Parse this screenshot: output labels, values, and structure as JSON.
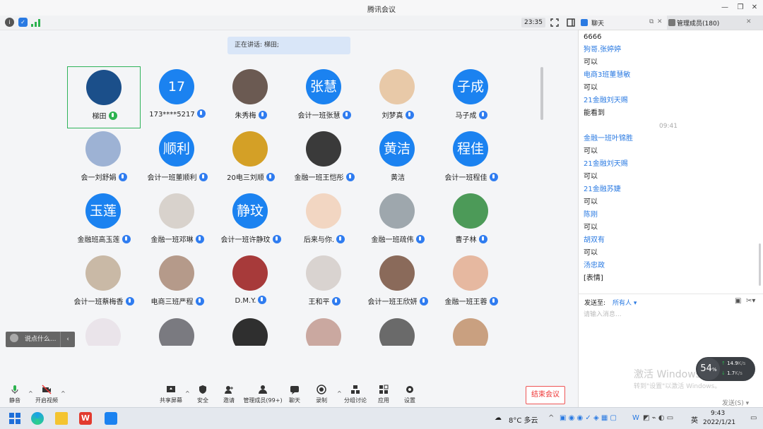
{
  "app": {
    "title": "腾讯会议"
  },
  "meeting": {
    "time": "23:35",
    "speaking_label": "正在讲话: 梯田;",
    "participants": [
      {
        "name": "梯田",
        "avatar_text": "",
        "avatar_color": "#1b4f8a",
        "mic": "green",
        "selected": true
      },
      {
        "name": "173****5217",
        "avatar_text": "17",
        "mic": "blue"
      },
      {
        "name": "朱秀梅",
        "avatar_text": "",
        "avatar_color": "#6b5a52",
        "mic": "blue"
      },
      {
        "name": "会计一班张慧",
        "avatar_text": "张慧",
        "mic": "blue"
      },
      {
        "name": "刘梦真",
        "avatar_text": "",
        "avatar_color": "#e8c9a8",
        "mic": "blue"
      },
      {
        "name": "马子成",
        "avatar_text": "子成",
        "mic": "blue"
      },
      {
        "name": "会一刘舒娟",
        "avatar_text": "",
        "avatar_color": "#9db2d4",
        "mic": "blue"
      },
      {
        "name": "会计一班董顺利",
        "avatar_text": "顺利",
        "mic": "blue"
      },
      {
        "name": "20电三刘顺",
        "avatar_text": "",
        "avatar_color": "#d4a026",
        "mic": "blue"
      },
      {
        "name": "金融一班王恺彤",
        "avatar_text": "",
        "avatar_color": "#3a3a3a",
        "mic": "blue"
      },
      {
        "name": "黄洁",
        "avatar_text": "黄洁",
        "mic": "none"
      },
      {
        "name": "会计一班程佳",
        "avatar_text": "程佳",
        "mic": "blue"
      },
      {
        "name": "金融班高玉莲",
        "avatar_text": "玉莲",
        "mic": "blue"
      },
      {
        "name": "金融一班邓琳",
        "avatar_text": "",
        "avatar_color": "#d8d2cc",
        "mic": "blue"
      },
      {
        "name": "会计一班许静玟",
        "avatar_text": "静玟",
        "mic": "blue"
      },
      {
        "name": "后来与你.",
        "avatar_text": "",
        "avatar_color": "#f2d6c2",
        "mic": "blue"
      },
      {
        "name": "金融一班疏伟",
        "avatar_text": "",
        "avatar_color": "#9ea7ad",
        "mic": "blue"
      },
      {
        "name": "曹子林",
        "avatar_text": "",
        "avatar_color": "#4c9a58",
        "mic": "blue"
      },
      {
        "name": "会计一班蔡梅香",
        "avatar_text": "",
        "avatar_color": "#c9b9a6",
        "mic": "blue"
      },
      {
        "name": "电商三班严程",
        "avatar_text": "",
        "avatar_color": "#b59a8a",
        "mic": "blue"
      },
      {
        "name": "D.M.Y.",
        "avatar_text": "",
        "avatar_color": "#a73a3a",
        "mic": "blue"
      },
      {
        "name": "王和平",
        "avatar_text": "",
        "avatar_color": "#d9d3d0",
        "mic": "blue"
      },
      {
        "name": "会计一班王欣妍",
        "avatar_text": "",
        "avatar_color": "#8a6a5a",
        "mic": "blue"
      },
      {
        "name": "金融一班王蓉",
        "avatar_text": "",
        "avatar_color": "#e6b8a0",
        "mic": "blue"
      }
    ],
    "partial_row_colors": [
      "#eae4ea",
      "#7a7a80",
      "#2f2f2f",
      "#caa8a0",
      "#6a6a6a",
      "#c9a080"
    ],
    "talk_hint": "说点什么...",
    "controls": [
      {
        "label": "静音",
        "icon": "mic-icon"
      },
      {
        "label": "开启视频",
        "icon": "video-off-icon"
      },
      {
        "label": "共享屏幕",
        "icon": "share-screen-icon"
      },
      {
        "label": "安全",
        "icon": "shield-icon"
      },
      {
        "label": "邀请",
        "icon": "invite-icon"
      },
      {
        "label": "管理成员(99+)",
        "icon": "members-icon"
      },
      {
        "label": "聊天",
        "icon": "chat-icon"
      },
      {
        "label": "录制",
        "icon": "record-icon"
      },
      {
        "label": "分组讨论",
        "icon": "breakout-icon"
      },
      {
        "label": "应用",
        "icon": "apps-icon"
      },
      {
        "label": "设置",
        "icon": "gear-icon"
      }
    ],
    "end_label": "结束会议"
  },
  "chat": {
    "tab_chat": "聊天",
    "tab_members": "管理成员(180)",
    "lines": [
      {
        "t": "6666",
        "k": "msg"
      },
      {
        "t": "狗哥.张婷婷",
        "k": "sender"
      },
      {
        "t": "可以",
        "k": "msg"
      },
      {
        "t": "电商3班董慧敏",
        "k": "sender"
      },
      {
        "t": "可以",
        "k": "msg"
      },
      {
        "t": "21金融刘天赐",
        "k": "sender"
      },
      {
        "t": "能看到",
        "k": "msg"
      },
      {
        "t": "09:41",
        "k": "time"
      },
      {
        "t": "金融一班叶锦胜",
        "k": "sender"
      },
      {
        "t": "可以",
        "k": "msg"
      },
      {
        "t": "21金融刘天赐",
        "k": "sender"
      },
      {
        "t": "可以",
        "k": "msg"
      },
      {
        "t": "21金融苏婕",
        "k": "sender"
      },
      {
        "t": "可以",
        "k": "msg"
      },
      {
        "t": "陈刚",
        "k": "sender"
      },
      {
        "t": "可以",
        "k": "msg"
      },
      {
        "t": "胡双有",
        "k": "sender"
      },
      {
        "t": "可以",
        "k": "msg"
      },
      {
        "t": "汤忠政",
        "k": "sender"
      },
      {
        "t": "[表情]",
        "k": "msg"
      }
    ],
    "send_to_label": "发送至:",
    "send_to_value": "所有人",
    "input_placeholder": "请输入消息...",
    "send_button": "发送(S)"
  },
  "watermark": {
    "line1": "激活 Windows",
    "line2": "转到\"设置\"以激活 Windows。"
  },
  "network": {
    "percent": "54",
    "percent_unit": "%",
    "up": "14.9",
    "down": "1.7",
    "unit": "K/s"
  },
  "taskbar": {
    "weather": "8°C 多云",
    "lang": "英",
    "time": "9:43",
    "date": "2022/1/21"
  }
}
